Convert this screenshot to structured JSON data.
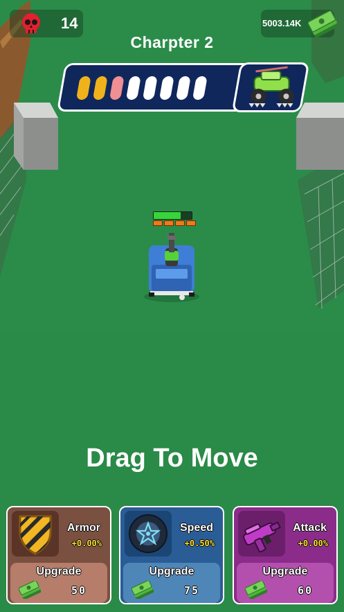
{
  "hud": {
    "kills": "14",
    "cash": "5003.14K",
    "chapter_title": "Charpter 2"
  },
  "progress": {
    "segments": [
      "gold",
      "gold",
      "pink",
      "white",
      "white",
      "white",
      "white",
      "white"
    ],
    "colors": {
      "gold": "#f0b21b",
      "pink": "#ee8f93",
      "white": "#ffffff"
    },
    "boss_icon": "monster-truck-icon"
  },
  "prompt": "Drag To Move",
  "player": {
    "health_fraction": 0.7,
    "ammo_pips": 4
  },
  "cards": [
    {
      "id": "armor",
      "name": "Armor",
      "bonus": "+0.00%",
      "button": "Upgrade",
      "price": "50",
      "icon": "shield-icon",
      "bg": "#7a5040",
      "btn_bg": "#b57d6a"
    },
    {
      "id": "speed",
      "name": "Speed",
      "bonus": "+0.50%",
      "button": "Upgrade",
      "price": "75",
      "icon": "wheel-icon",
      "bg": "#2a5d96",
      "btn_bg": "#4e86b8"
    },
    {
      "id": "attack",
      "name": "Attack",
      "bonus": "+0.00%",
      "button": "Upgrade",
      "price": "60",
      "icon": "blaster-gun-icon",
      "bg": "#8c2c8a",
      "btn_bg": "#b350ad"
    }
  ]
}
